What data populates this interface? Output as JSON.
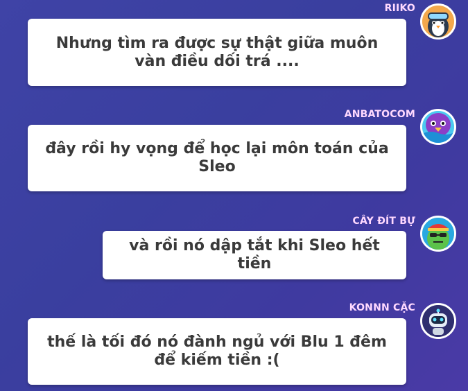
{
  "messages": [
    {
      "author": "RIIKO",
      "text": "Nhưng tìm ra được sự thật giữa muôn vàn điều dối trá ...."
    },
    {
      "author": "ANBATOCOM",
      "text": "đây rồi hy vọng để học lại môn toán của Sleo"
    },
    {
      "author": "CÂY ĐÍT BỰ",
      "text": "và rồi nó dập tắt khi Sleo hết tiền"
    },
    {
      "author": "KONNN CẶC",
      "text": "thế là tối đó nó đành ngủ với Blu 1 đêm để kiếm tiền :("
    }
  ],
  "colors": {
    "author": "#ffd9ff",
    "bubble": "#ffffff",
    "text": "#3a3a3a"
  }
}
